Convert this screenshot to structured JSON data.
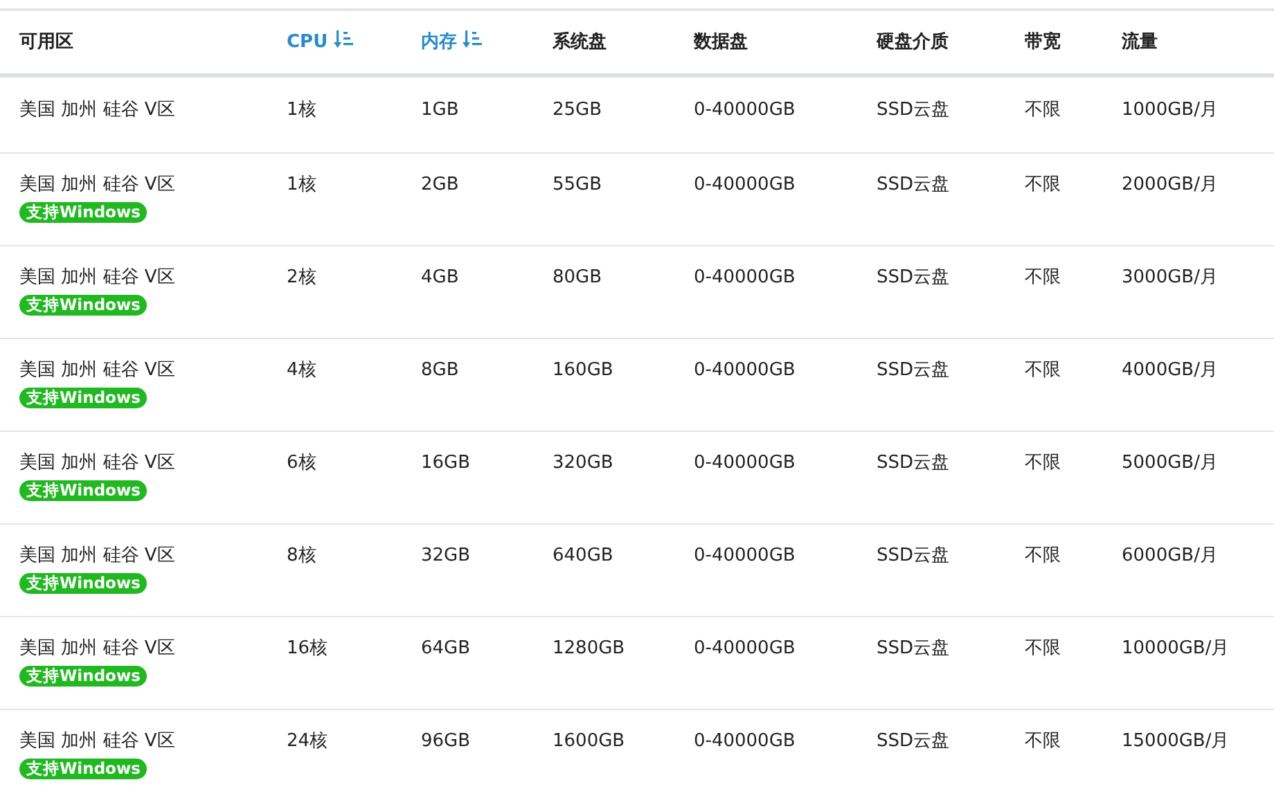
{
  "table": {
    "columns": [
      {
        "label": "可用区",
        "sortable": false
      },
      {
        "label": "CPU",
        "sortable": true
      },
      {
        "label": "内存",
        "sortable": true
      },
      {
        "label": "系统盘",
        "sortable": false
      },
      {
        "label": "数据盘",
        "sortable": false
      },
      {
        "label": "硬盘介质",
        "sortable": false
      },
      {
        "label": "带宽",
        "sortable": false
      },
      {
        "label": "流量",
        "sortable": false
      }
    ],
    "rows": [
      {
        "cells": [
          "美国 加州 硅谷 V区",
          "1核",
          "1GB",
          "25GB",
          "0-40000GB",
          "SSD云盘",
          "不限",
          "1000GB/月"
        ]
      },
      {
        "cells": [
          "美国 加州 硅谷 V区",
          "1核",
          "2GB",
          "55GB",
          "0-40000GB",
          "SSD云盘",
          "不限",
          "2000GB/月"
        ],
        "badge": "支持Windows"
      },
      {
        "cells": [
          "美国 加州 硅谷 V区",
          "2核",
          "4GB",
          "80GB",
          "0-40000GB",
          "SSD云盘",
          "不限",
          "3000GB/月"
        ],
        "badge": "支持Windows"
      },
      {
        "cells": [
          "美国 加州 硅谷 V区",
          "4核",
          "8GB",
          "160GB",
          "0-40000GB",
          "SSD云盘",
          "不限",
          "4000GB/月"
        ],
        "badge": "支持Windows"
      },
      {
        "cells": [
          "美国 加州 硅谷 V区",
          "6核",
          "16GB",
          "320GB",
          "0-40000GB",
          "SSD云盘",
          "不限",
          "5000GB/月"
        ],
        "badge": "支持Windows"
      },
      {
        "cells": [
          "美国 加州 硅谷 V区",
          "8核",
          "32GB",
          "640GB",
          "0-40000GB",
          "SSD云盘",
          "不限",
          "6000GB/月"
        ],
        "badge": "支持Windows"
      },
      {
        "cells": [
          "美国 加州 硅谷 V区",
          "16核",
          "64GB",
          "1280GB",
          "0-40000GB",
          "SSD云盘",
          "不限",
          "10000GB/月"
        ],
        "badge": "支持Windows"
      },
      {
        "cells": [
          "美国 加州 硅谷 V区",
          "24核",
          "96GB",
          "1600GB",
          "0-40000GB",
          "SSD云盘",
          "不限",
          "15000GB/月"
        ],
        "badge": "支持Windows"
      }
    ]
  }
}
